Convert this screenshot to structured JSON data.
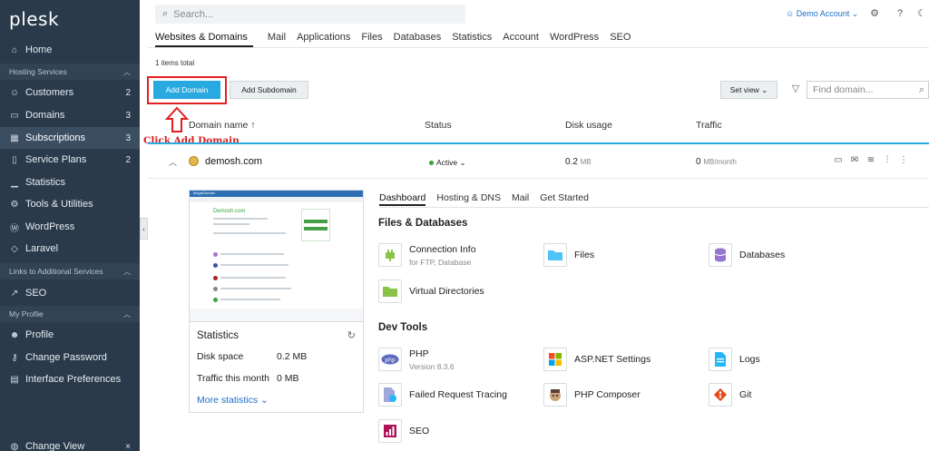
{
  "logo": "plesk",
  "sidebar": {
    "items": [
      {
        "label": "Home",
        "icon": "home-icon",
        "glyph": "⌂"
      },
      {
        "group": "Hosting Services"
      },
      {
        "label": "Customers",
        "icon": "user-icon",
        "glyph": "☺",
        "count": "2"
      },
      {
        "label": "Domains",
        "icon": "monitor-icon",
        "glyph": "▭",
        "count": "3"
      },
      {
        "label": "Subscriptions",
        "icon": "grid-icon",
        "glyph": "▦",
        "count": "3",
        "active": true
      },
      {
        "label": "Service Plans",
        "icon": "book-icon",
        "glyph": "▯",
        "count": "2"
      },
      {
        "label": "Statistics",
        "icon": "chart-icon",
        "glyph": "▁"
      },
      {
        "label": "Tools & Utilities",
        "icon": "sliders-icon",
        "glyph": "⚙"
      },
      {
        "label": "WordPress",
        "icon": "wordpress-icon",
        "glyph": "Ⓦ"
      },
      {
        "label": "Laravel",
        "icon": "laravel-icon",
        "glyph": "◇"
      },
      {
        "group": "Links to Additional Services"
      },
      {
        "label": "SEO",
        "icon": "seo-icon",
        "glyph": "↗"
      },
      {
        "group": "My Profile"
      },
      {
        "label": "Profile",
        "icon": "profile-icon",
        "glyph": "☻"
      },
      {
        "label": "Change Password",
        "icon": "key-icon",
        "glyph": "⚷"
      },
      {
        "label": "Interface Preferences",
        "icon": "preferences-icon",
        "glyph": "▤"
      }
    ],
    "footer": {
      "label": "Change View",
      "close": "×"
    }
  },
  "topbar": {
    "search_placeholder": "Search...",
    "account": "Demo Account ⌄"
  },
  "tabs": [
    "Websites & Domains",
    "Mail",
    "Applications",
    "Files",
    "Databases",
    "Statistics",
    "Account",
    "WordPress",
    "SEO"
  ],
  "items_total": "1 items total",
  "buttons": {
    "add_domain": "Add Domain",
    "add_subdomain": "Add Subdomain",
    "set_view": "Set view ⌄",
    "find_placeholder": "Find domain..."
  },
  "annotation": "Click Add Domain",
  "table": {
    "headers": {
      "domain": "Domain name ↑",
      "status": "Status",
      "disk": "Disk usage",
      "traffic": "Traffic"
    },
    "row": {
      "domain": "demosh.com",
      "status": "Active ⌄",
      "disk_value": "0.2",
      "disk_unit": "MB",
      "traffic_value": "0",
      "traffic_unit": "MB/month"
    }
  },
  "preview": {
    "brand": "MegaDomain",
    "title": "Demosh.com"
  },
  "stats": {
    "title": "Statistics",
    "disk_label": "Disk space",
    "disk_value": "0.2 MB",
    "traffic_label": "Traffic this month",
    "traffic_value": "0 MB",
    "more": "More statistics ⌄"
  },
  "detail_tabs": [
    "Dashboard",
    "Hosting & DNS",
    "Mail",
    "Get Started"
  ],
  "sections": {
    "files": "Files & Databases",
    "dev": "Dev Tools"
  },
  "tools": {
    "connection_info": {
      "name": "Connection Info",
      "sub": "for FTP, Database"
    },
    "files": {
      "name": "Files"
    },
    "databases": {
      "name": "Databases"
    },
    "virtual_dirs": {
      "name": "Virtual Directories"
    },
    "php": {
      "name": "PHP",
      "sub": "Version 8.3.6"
    },
    "aspnet": {
      "name": "ASP.NET Settings"
    },
    "logs": {
      "name": "Logs"
    },
    "failed_tracing": {
      "name": "Failed Request Tracing"
    },
    "php_composer": {
      "name": "PHP Composer"
    },
    "git": {
      "name": "Git"
    },
    "seo": {
      "name": "SEO"
    }
  },
  "colors": {
    "sidebar": "#2b3a4a",
    "accent": "#28aae1",
    "annotation": "#d32020",
    "link": "#1e6ec8"
  }
}
